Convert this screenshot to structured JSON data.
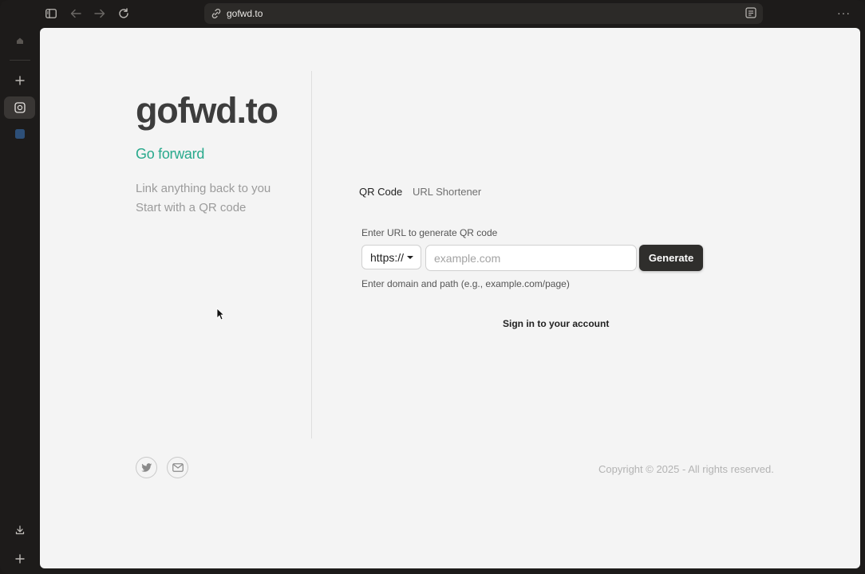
{
  "browser": {
    "url": "gofwd.to",
    "icons": [
      "sidebar-toggle-icon",
      "back-arrow-icon",
      "forward-arrow-icon",
      "reload-icon",
      "link-icon",
      "extension-icon",
      "more-icon"
    ]
  },
  "sidebar": {
    "items": [
      "home-icon",
      "plus-icon",
      "space-icon",
      "square-icon",
      "download-icon",
      "plus-icon"
    ]
  },
  "hero": {
    "title": "gofwd.to",
    "tagline": "Go forward",
    "line1": "Link anything back to you",
    "line2": "Start with a QR code"
  },
  "tabs": {
    "qr": "QR Code",
    "shortener": "URL Shortener"
  },
  "form": {
    "label": "Enter URL to generate QR code",
    "protocol": "https://",
    "placeholder": "example.com",
    "button": "Generate",
    "helper": "Enter domain and path (e.g., example.com/page)"
  },
  "signin": "Sign in to your account",
  "footer": {
    "copyright": "Copyright © 2025 - All rights reserved."
  },
  "colors": {
    "accent": "#28a98c",
    "button": "#2f2e2c",
    "page_bg": "#f4f4f4"
  }
}
